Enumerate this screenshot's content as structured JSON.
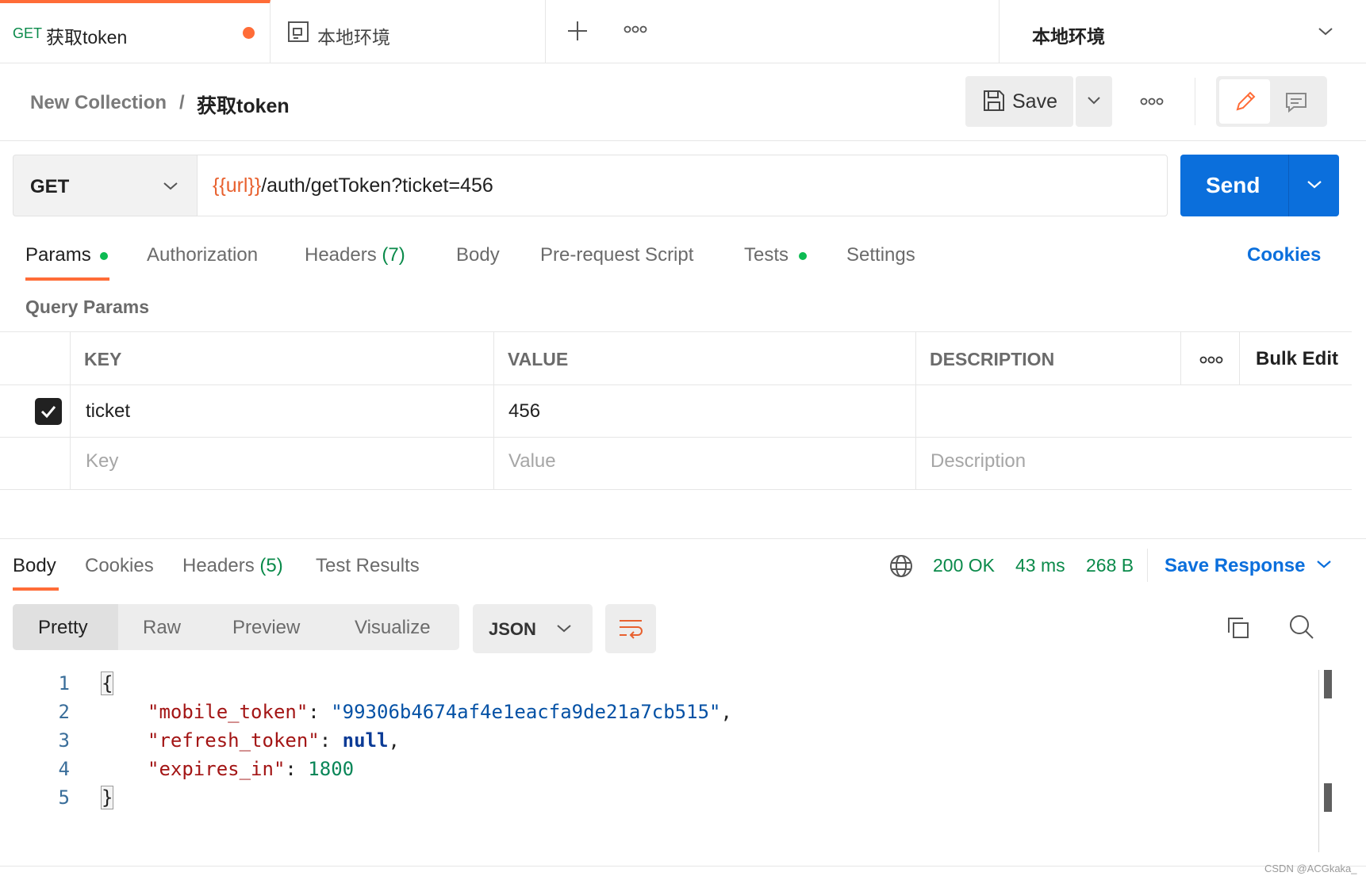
{
  "tabs": {
    "active": {
      "method": "GET",
      "name": "获取token"
    },
    "second": {
      "label": "本地环境"
    }
  },
  "environment": {
    "selected": "本地环境"
  },
  "breadcrumb": {
    "parent": "New Collection",
    "separator": "/",
    "current": "获取token"
  },
  "toolbar": {
    "save_label": "Save"
  },
  "request": {
    "method": "GET",
    "url_var": "{{url}}",
    "url_path": "/auth/getToken?ticket=456",
    "send_label": "Send"
  },
  "request_tabs": {
    "params": "Params",
    "authorization": "Authorization",
    "headers": "Headers",
    "headers_count": "(7)",
    "body": "Body",
    "prerequest": "Pre-request Script",
    "tests": "Tests",
    "settings": "Settings",
    "cookies": "Cookies"
  },
  "params": {
    "title": "Query Params",
    "columns": {
      "key": "KEY",
      "value": "VALUE",
      "description": "DESCRIPTION",
      "bulk_edit": "Bulk Edit"
    },
    "rows": [
      {
        "checked": true,
        "key": "ticket",
        "value": "456",
        "description": ""
      }
    ],
    "placeholders": {
      "key": "Key",
      "value": "Value",
      "description": "Description"
    }
  },
  "response": {
    "tabs": {
      "body": "Body",
      "cookies": "Cookies",
      "headers": "Headers",
      "headers_count": "(5)",
      "tests": "Test Results"
    },
    "status": "200 OK",
    "time": "43 ms",
    "size": "268 B",
    "save_label": "Save Response",
    "views": [
      "Pretty",
      "Raw",
      "Preview",
      "Visualize"
    ],
    "format": "JSON",
    "line_numbers": [
      "1",
      "2",
      "3",
      "4",
      "5"
    ],
    "body": {
      "open": "{",
      "close": "}",
      "k1": "\"mobile_token\"",
      "v1": "\"99306b4674af4e1eacfa9de21a7cb515\"",
      "k2": "\"refresh_token\"",
      "v2": "null",
      "k3": "\"expires_in\"",
      "v3": "1800",
      "colon": ": ",
      "comma": ","
    }
  },
  "watermark": "CSDN @ACGkaka_",
  "colors": {
    "accent": "#ff6c37",
    "primary": "#0b6fdc",
    "success": "#0a8a4a"
  }
}
